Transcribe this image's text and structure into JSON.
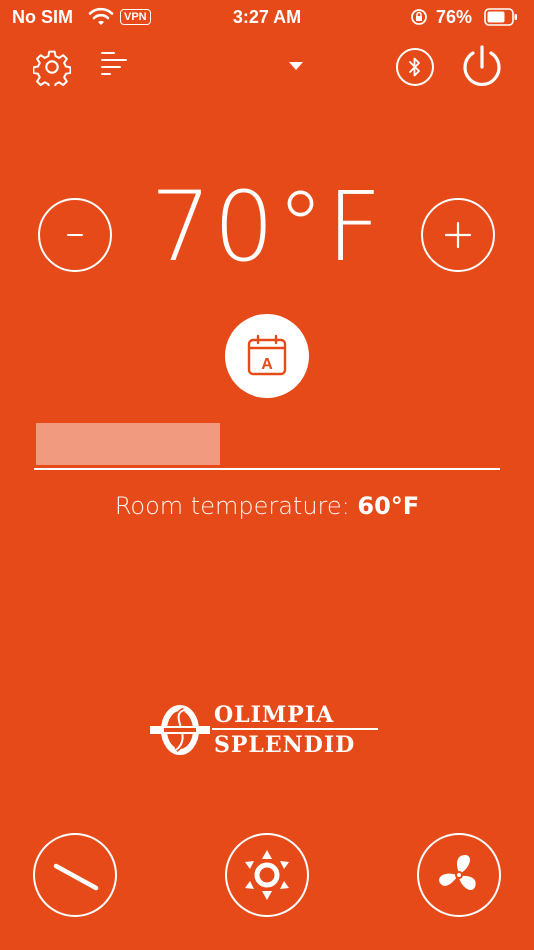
{
  "status_bar": {
    "carrier": "No SIM",
    "vpn": "VPN",
    "time": "3:27 AM",
    "battery_pct": "76%"
  },
  "header": {
    "icons": [
      "gear-icon",
      "menu-lines-icon",
      "dropdown-arrow-icon",
      "bluetooth-icon",
      "power-icon"
    ]
  },
  "temperature": {
    "setpoint": "70°F",
    "decrease_label": "-",
    "increase_label": "+"
  },
  "schedule": {
    "icon": "calendar-a-icon",
    "letter": "A"
  },
  "room": {
    "label": "Room temperature: ",
    "value": "60°F"
  },
  "brand": {
    "line1": "OLIMPIA",
    "line2": "SPLENDID"
  },
  "bottom_controls": {
    "icons": [
      "mode-slash-icon",
      "sun-icon",
      "fan-icon"
    ]
  },
  "colors": {
    "background": "#e64a19",
    "foreground": "#ffffff",
    "input_fill": "#f29a80"
  }
}
